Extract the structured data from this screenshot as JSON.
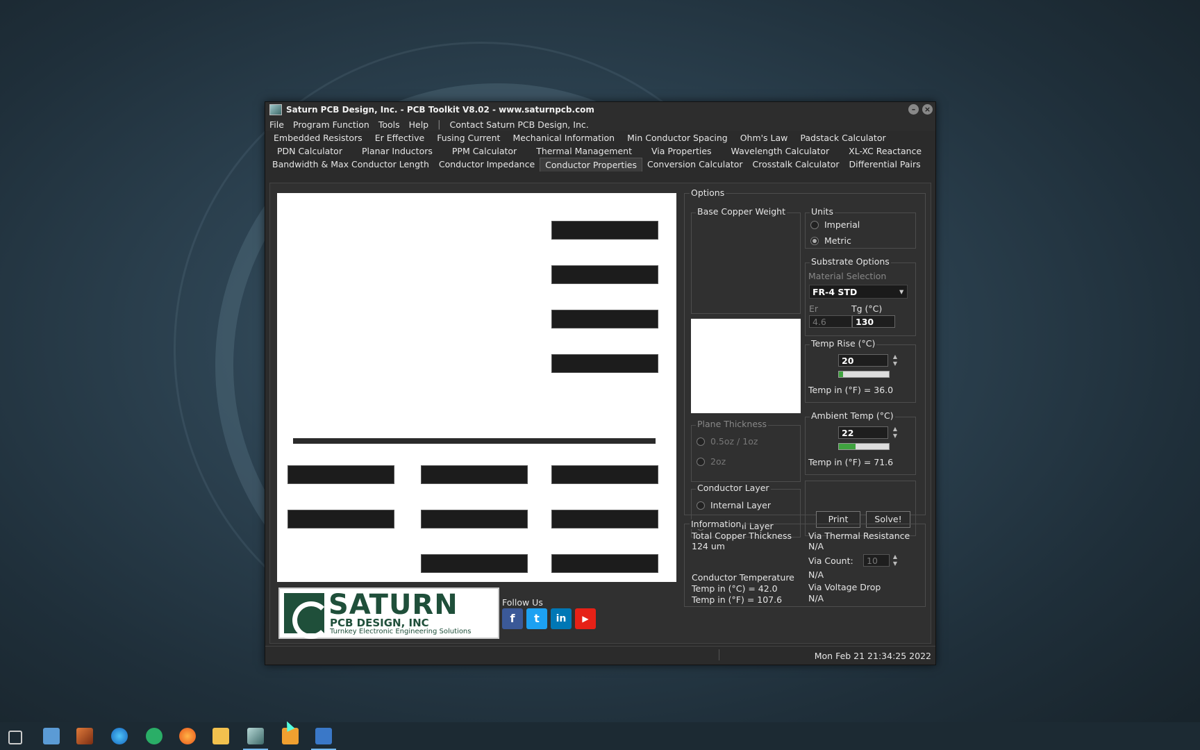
{
  "window": {
    "title": "Saturn PCB Design, Inc. - PCB Toolkit V8.02 - www.saturnpcb.com",
    "minimize_glyph": "–",
    "close_glyph": "×"
  },
  "menu": {
    "items": [
      "File",
      "Program Function",
      "Tools",
      "Help"
    ],
    "separator": "|",
    "contact": "Contact Saturn PCB Design, Inc."
  },
  "tabs": {
    "row1": [
      "Embedded Resistors",
      "Er Effective",
      "Fusing Current",
      "Mechanical Information",
      "Min Conductor Spacing",
      "Ohm's Law",
      "Padstack Calculator"
    ],
    "row2": [
      "PDN Calculator",
      "Planar Inductors",
      "PPM Calculator",
      "Thermal Management",
      "Via Properties",
      "Wavelength Calculator",
      "XL-XC Reactance"
    ],
    "row3": [
      "Bandwidth & Max Conductor Length",
      "Conductor Impedance",
      "Conductor Properties",
      "Conversion Calculator",
      "Crosstalk Calculator",
      "Differential Pairs"
    ],
    "active": "Conductor Properties"
  },
  "logo": {
    "big": "SATURN",
    "mid": "PCB DESIGN, INC",
    "small": "Turnkey Electronic Engineering Solutions"
  },
  "social": {
    "follow_label": "Follow Us",
    "facebook": "f",
    "twitter": "t",
    "linkedin": "in",
    "youtube": "▶"
  },
  "options": {
    "label": "Options",
    "base_copper_label": "Base Copper Weight",
    "plane_thickness": {
      "label": "Plane Thickness",
      "opt1": "0.5oz / 1oz",
      "opt2": "2oz"
    },
    "conductor_layer": {
      "label": "Conductor Layer",
      "internal": "Internal Layer",
      "external": "External Layer",
      "selected": "External Layer"
    },
    "units": {
      "label": "Units",
      "imperial": "Imperial",
      "metric": "Metric",
      "selected": "Metric"
    },
    "substrate": {
      "label": "Substrate Options",
      "material_label": "Material Selection",
      "material_value": "FR-4 STD",
      "dropdown_glyph": "▾",
      "er_label": "Er",
      "er_value": "4.6",
      "tg_label": "Tg (°C)",
      "tg_value": "130"
    },
    "temp_rise": {
      "label": "Temp Rise (°C)",
      "value": "20",
      "fahrenheit": "Temp in (°F) = 36.0",
      "slider_fraction": 0.08
    },
    "ambient": {
      "label": "Ambient Temp (°C)",
      "value": "22",
      "fahrenheit": "Temp in (°F) = 71.6",
      "slider_fraction": 0.33
    },
    "spin_glyph": "▲\n▼",
    "print_label": "Print",
    "solve_label": "Solve!"
  },
  "information": {
    "label": "Information",
    "total_copper_label": "Total Copper Thickness",
    "total_copper_value": "124 um",
    "conductor_temp_label": "Conductor Temperature",
    "temp_c": "Temp in (°C) = 42.0",
    "temp_f": "Temp in (°F) = 107.6",
    "via_thermal_label": "Via Thermal Resistance",
    "via_thermal_value": "N/A",
    "via_count_label": "Via Count:",
    "via_count_value": "10",
    "via_count_result": "N/A",
    "via_drop_label": "Via Voltage Drop",
    "via_drop_value": "N/A"
  },
  "status": {
    "datetime": "Mon Feb 21 21:34:25 2022"
  },
  "colors": {
    "accent_green": "#3fa33f",
    "logo_green": "#1f4f3a",
    "taskbar_active": "#76b9ed"
  }
}
